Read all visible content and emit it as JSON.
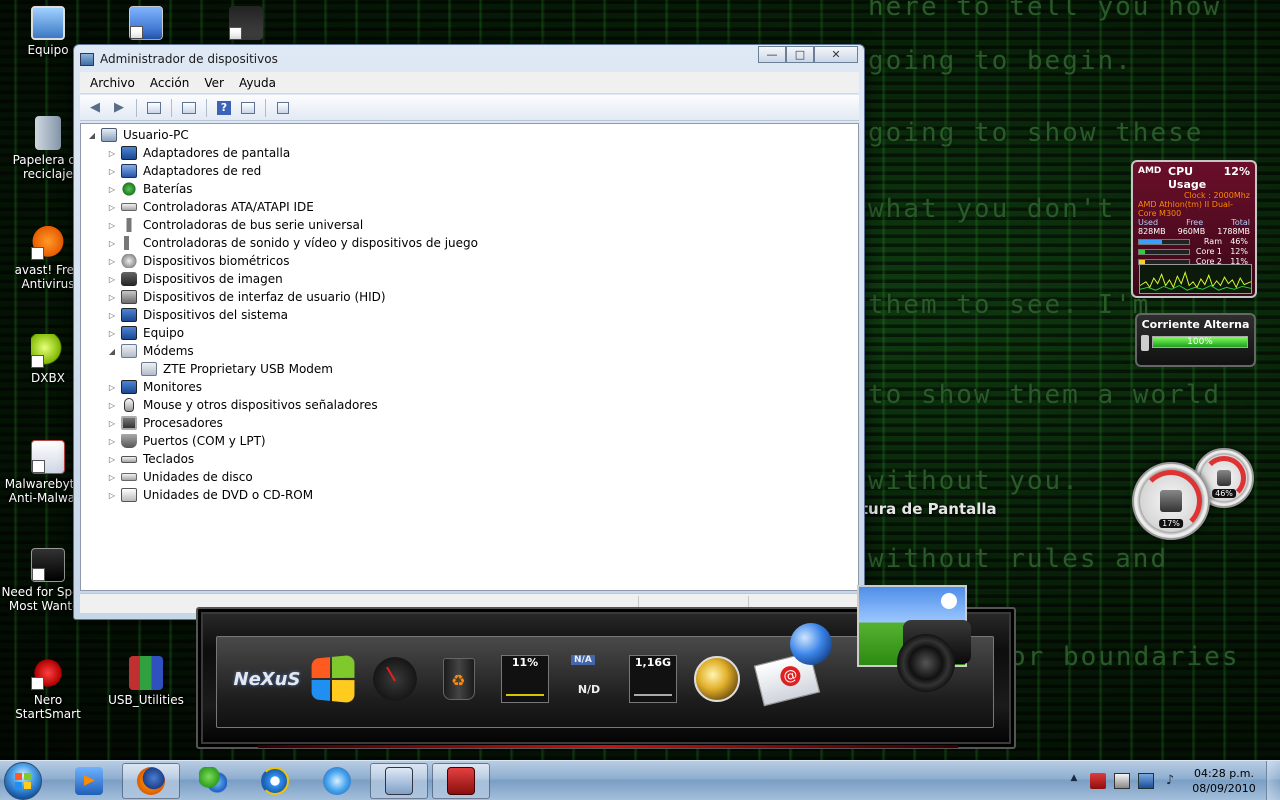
{
  "desktop": {
    "icons": [
      {
        "label": "Equipo"
      },
      {
        "label": "Papelera de reciclaje"
      },
      {
        "label": "avast! Free Antivirus"
      },
      {
        "label": "DXBX"
      },
      {
        "label": "Malwarebytes' Anti-Malware"
      },
      {
        "label": "Need for Speed Most Wanted"
      },
      {
        "label": "Nero StartSmart"
      },
      {
        "label": "USB_Utilities"
      }
    ],
    "matrix_lines": [
      "here to tell you how",
      "going to begin.",
      "going to show these",
      "what you don't",
      "them to see. I'm",
      "to show them a world",
      "without you.",
      "without rules and",
      "or boundaries"
    ],
    "capture_label": "Captura de Pantalla"
  },
  "window": {
    "title": "Administrador de dispositivos",
    "buttons": {
      "minimize": "—",
      "maximize": "□",
      "close": "✕"
    },
    "menu": [
      "Archivo",
      "Acción",
      "Ver",
      "Ayuda"
    ],
    "tree": {
      "root": "Usuario-PC",
      "items": [
        "Adaptadores de pantalla",
        "Adaptadores de red",
        "Baterías",
        "Controladoras ATA/ATAPI IDE",
        "Controladoras de bus serie universal",
        "Controladoras de sonido y vídeo y dispositivos de juego",
        "Dispositivos biométricos",
        "Dispositivos de imagen",
        "Dispositivos de interfaz de usuario (HID)",
        "Dispositivos del sistema",
        "Equipo",
        "Módems",
        "ZTE Proprietary USB Modem",
        "Monitores",
        "Mouse y otros dispositivos señaladores",
        "Procesadores",
        "Puertos (COM y LPT)",
        "Teclados",
        "Unidades de disco",
        "Unidades de DVD o CD-ROM"
      ]
    }
  },
  "gadgets": {
    "cpu": {
      "brand": "AMD",
      "title": "CPU Usage",
      "usage": "12%",
      "clock": "Clock : 2000Mhz",
      "model": "AMD Athlon(tm) II Dual-Core M300",
      "mem_headers": [
        "Used",
        "Free",
        "Total"
      ],
      "mem_values": [
        "828MB",
        "960MB",
        "1788MB"
      ],
      "bars": [
        {
          "name": "Ram",
          "value": "46%",
          "level": 0.46,
          "color": "#3aa0ff"
        },
        {
          "name": "Core 1",
          "value": "12%",
          "level": 0.12,
          "color": "#2fd02f"
        },
        {
          "name": "Core 2",
          "value": "11%",
          "level": 0.11,
          "color": "#ffcf1f"
        }
      ]
    },
    "power": {
      "title": "Corriente Alterna",
      "percent": "100%",
      "level": 1.0
    },
    "gauges": {
      "cpu": "17%",
      "mem": "46%"
    }
  },
  "dock": {
    "nexus_label": "NeXuS",
    "cpu_meter": "11%",
    "na_label": "N/A",
    "nd_label": "N/D",
    "disk_meter": "1,16G"
  },
  "taskbar": {
    "time": "04:28 p.m.",
    "date": "08/09/2010",
    "tray_arrow": "▲"
  }
}
